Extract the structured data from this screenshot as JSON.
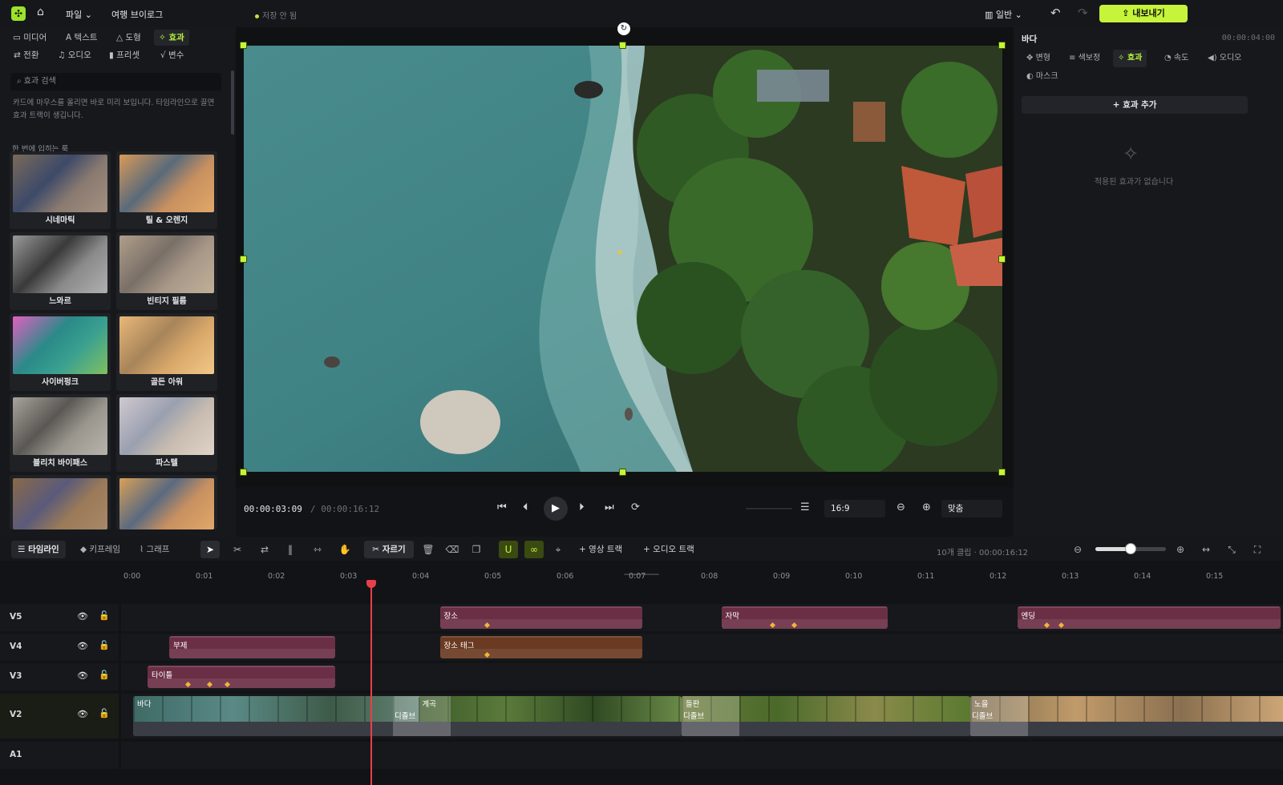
{
  "app": {
    "menu_file": "파일",
    "project_title": "여행 브이로그",
    "save_status": "저장 안 됨",
    "view_mode": "일반",
    "export_label": "내보내기",
    "accent": "#c6f43a"
  },
  "left_panel": {
    "tabs_row1": [
      "미디어",
      "텍스트",
      "도형",
      "효과"
    ],
    "tabs_row2": [
      "전환",
      "오디오",
      "프리셋",
      "변수"
    ],
    "active_tab": "효과",
    "search_placeholder": "효과 검색",
    "hint": "카드에 마우스를 올리면 바로 미리 보입니다. 타임라인으로 끌면 효과 트랙이 생깁니다.",
    "section_label": "한 번에 입히는 룩",
    "effects": [
      {
        "label": "시네마틱"
      },
      {
        "label": "틸 & 오렌지"
      },
      {
        "label": "느와르"
      },
      {
        "label": "빈티지 필름"
      },
      {
        "label": "사이버펑크"
      },
      {
        "label": "골든 아워"
      },
      {
        "label": "블리치 바이패스"
      },
      {
        "label": "파스텔"
      },
      {
        "label": ""
      },
      {
        "label": ""
      }
    ]
  },
  "transport": {
    "current_time": "00:00:03:09",
    "total_time": "/ 00:00:16:12",
    "aspect_ratio": "16:9",
    "zoom_fit": "맞춤"
  },
  "right_panel": {
    "clip_name": "바다",
    "clip_time": "00:00:04:00",
    "tabs": [
      "변형",
      "색보정",
      "효과",
      "속도",
      "오디오",
      "마스크"
    ],
    "active_tab": "효과",
    "add_effect_label": "효과 추가",
    "empty_text": "적용된 효과가 없습니다"
  },
  "timeline": {
    "tabs": [
      "타임라인",
      "키프레임",
      "그래프"
    ],
    "active_tab": "타임라인",
    "cut_label": "자르기",
    "add_video_track": "영상 트랙",
    "add_audio_track": "오디오 트랙",
    "clip_count": "10개 클립 · 00:00:16:12",
    "zoom_level": 0.5,
    "ticks": [
      "0:00",
      "0:01",
      "0:02",
      "0:03",
      "0:04",
      "0:05",
      "0:06",
      "0:07",
      "0:08",
      "0:09",
      "0:10",
      "0:11",
      "0:12",
      "0:13",
      "0:14",
      "0:15"
    ],
    "tracks": [
      {
        "name": "V5",
        "clips": [
          {
            "label": "장소",
            "start": 4.25,
            "end": 7.05,
            "color": "#6b2f45",
            "keyframes": [
              4.9
            ]
          },
          {
            "label": "자막",
            "start": 8.15,
            "end": 10.45,
            "color": "#6b2f45",
            "keyframes": [
              8.85,
              9.15
            ]
          },
          {
            "label": "엔딩",
            "start": 12.25,
            "end": 15.9,
            "color": "#6b2f45",
            "keyframes": [
              12.65,
              12.85
            ]
          }
        ]
      },
      {
        "name": "V4",
        "clips": [
          {
            "label": "부제",
            "start": 0.5,
            "end": 2.8,
            "color": "#6b2f45",
            "keyframes": []
          },
          {
            "label": "장소 태그",
            "start": 4.25,
            "end": 7.05,
            "color": "#6b3a22",
            "keyframes": [
              4.9
            ]
          }
        ]
      },
      {
        "name": "V3",
        "clips": [
          {
            "label": "타이틀",
            "start": 0.2,
            "end": 2.8,
            "color": "#6b2f45",
            "keyframes": [
              0.75,
              1.05,
              1.3
            ]
          }
        ]
      },
      {
        "name": "V2",
        "clips": [
          {
            "label": "바다",
            "start": 0,
            "end": 3.95
          },
          {
            "label": "계곡",
            "start": 3.95,
            "end": 7.6
          },
          {
            "label": "들판",
            "start": 7.6,
            "end": 11.6
          },
          {
            "label": "노을",
            "start": 11.6,
            "end": 16.0
          }
        ],
        "transitions": [
          {
            "label": "디졸브",
            "start": 3.6,
            "end": 4.4
          },
          {
            "label": "디졸브",
            "start": 7.6,
            "end": 8.4
          },
          {
            "label": "디졸브",
            "start": 11.6,
            "end": 12.4
          }
        ]
      },
      {
        "name": "A1",
        "clips": []
      }
    ],
    "playhead_time": 3.3
  }
}
